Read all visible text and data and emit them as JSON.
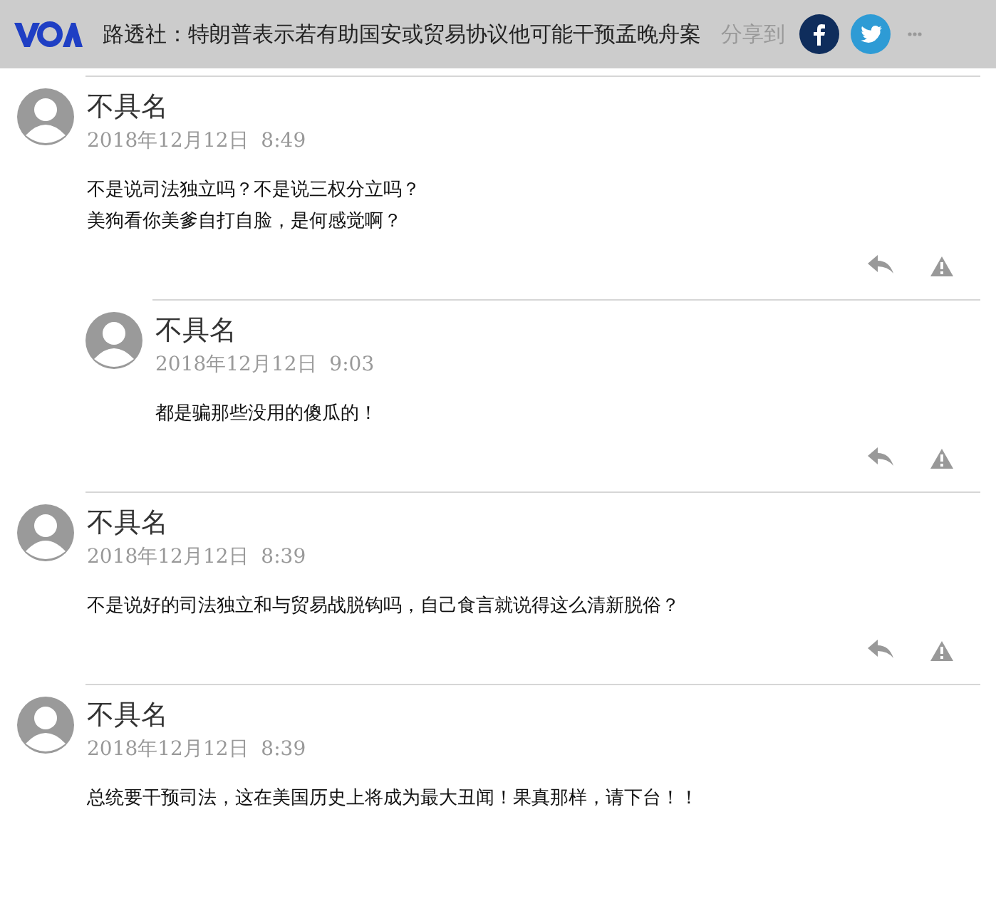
{
  "header": {
    "title": "路透社：特朗普表示若有助国安或贸易协议他可能干预孟晚舟案",
    "share_label": "分享到"
  },
  "comments": [
    {
      "author": "不具名",
      "time": "2018年12月12日  8:49",
      "body": [
        "不是说司法独立吗？不是说三权分立吗？",
        "美狗看你美爹自打自脸，是何感觉啊？"
      ],
      "replies": [
        {
          "author": "不具名",
          "time": "2018年12月12日  9:03",
          "body": [
            "都是骗那些没用的傻瓜的！"
          ]
        }
      ]
    },
    {
      "author": "不具名",
      "time": "2018年12月12日  8:39",
      "body": [
        "不是说好的司法独立和与贸易战脱钩吗，自己食言就说得这么清新脱俗？"
      ]
    },
    {
      "author": "不具名",
      "time": "2018年12月12日  8:39",
      "body": [
        "总统要干预司法，这在美国历史上将成为最大丑闻！果真那样，请下台！！"
      ]
    }
  ]
}
